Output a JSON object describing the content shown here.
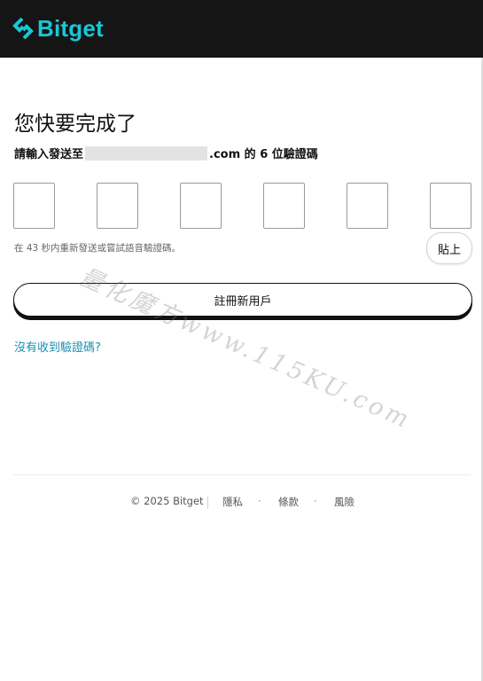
{
  "header": {
    "brand": "Bitget",
    "brand_color": "#1ac7d6",
    "background": "#151515"
  },
  "main": {
    "title": "您快要完成了",
    "subtitle_prefix": "請輸入發送至",
    "subtitle_suffix": ".com 的 6 位驗證碼",
    "code_boxes": [
      "",
      "",
      "",
      "",
      "",
      ""
    ],
    "resend_text": "在 43 秒内重新發送或嘗試語音驗證碼。",
    "paste_label": "貼上",
    "register_label": "註冊新用戶",
    "help_link": "沒有收到驗證碼?"
  },
  "footer": {
    "copyright": "© 2025 Bitget",
    "links": [
      "隱私",
      "條款",
      "風險"
    ]
  },
  "watermark": "量化魔方www.115KU.com"
}
